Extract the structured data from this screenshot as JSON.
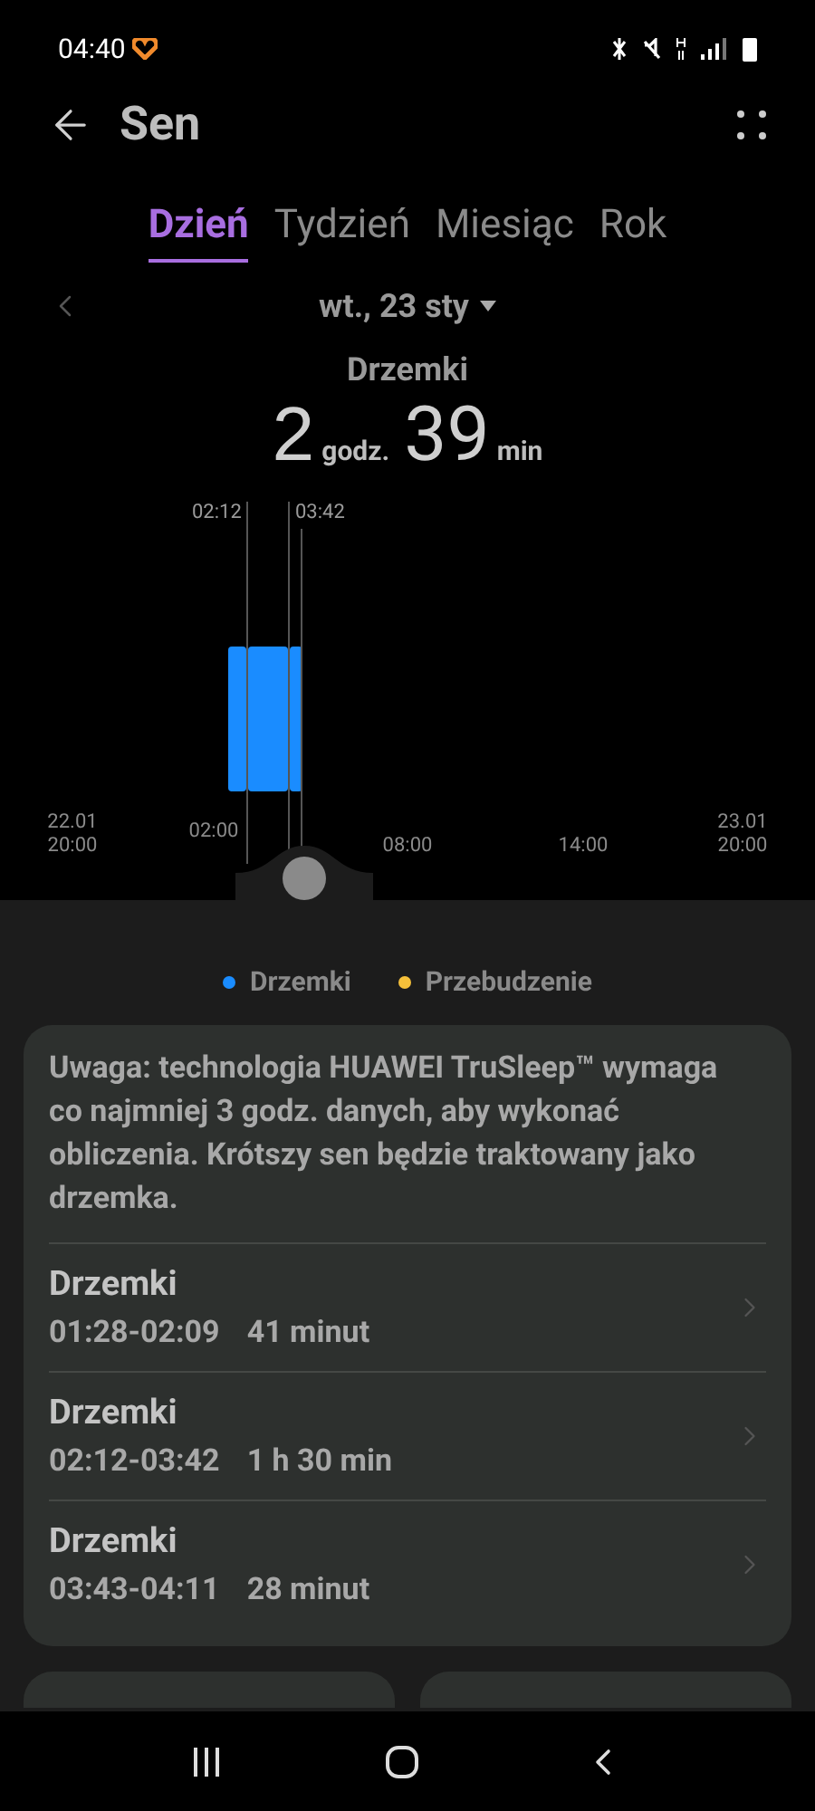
{
  "status_bar": {
    "time": "04:40"
  },
  "header": {
    "title": "Sen"
  },
  "tabs": [
    {
      "label": "Dzień",
      "selected": true
    },
    {
      "label": "Tydzień",
      "selected": false
    },
    {
      "label": "Miesiąc",
      "selected": false
    },
    {
      "label": "Rok",
      "selected": false
    }
  ],
  "date_picker": {
    "label": "wt., 23 sty"
  },
  "summary": {
    "label": "Drzemki",
    "hours": "2",
    "hours_unit": "godz.",
    "minutes": "39",
    "minutes_unit": "min"
  },
  "timeline": {
    "cursor_labels": [
      "02:12",
      "03:42"
    ],
    "axis_labels": [
      {
        "line1": "22.01",
        "line2": "20:00"
      },
      {
        "line2": "02:00"
      },
      {
        "line2": "08:00"
      },
      {
        "line2": "14:00"
      },
      {
        "line1": "23.01",
        "line2": "20:00"
      }
    ]
  },
  "legend": [
    {
      "label": "Drzemki",
      "color": "#1a8cff"
    },
    {
      "label": "Przebudzenie",
      "color": "#f5c03a"
    }
  ],
  "note": "Uwaga: technologia HUAWEI TruSleep™ wymaga co najmniej 3 godz. danych, aby wykonać obliczenia. Krótszy sen będzie traktowany jako drzemka.",
  "naps": [
    {
      "title": "Drzemki",
      "range": "01:28-02:09",
      "duration": "41 minut"
    },
    {
      "title": "Drzemki",
      "range": "02:12-03:42",
      "duration": "1 h 30 min"
    },
    {
      "title": "Drzemki",
      "range": "03:43-04:11",
      "duration": "28 minut"
    }
  ]
}
